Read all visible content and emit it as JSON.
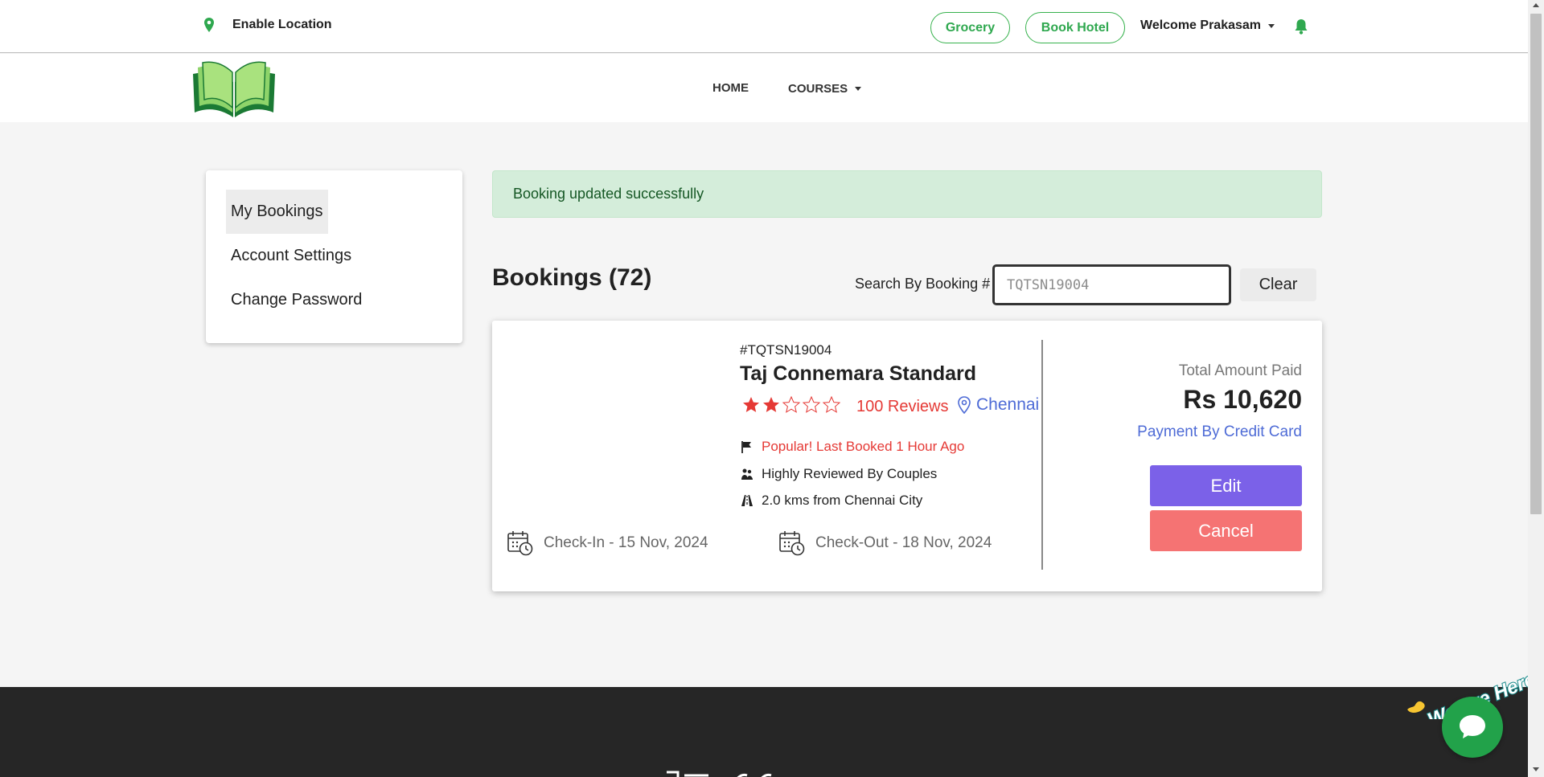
{
  "topbar": {
    "enable_location": "Enable Location",
    "grocery_label": "Grocery",
    "book_hotel_label": "Book Hotel",
    "welcome": "Welcome Prakasam"
  },
  "nav": {
    "home": "HOME",
    "courses": "COURSES"
  },
  "sidebar": {
    "items": [
      {
        "label": "My Bookings",
        "active": true
      },
      {
        "label": "Account Settings"
      },
      {
        "label": "Change Password"
      }
    ]
  },
  "alert": {
    "message": "Booking updated successfully"
  },
  "bookings": {
    "title": "Bookings (72)",
    "search_label": "Search By Booking #",
    "search_value": "TQTSN19004",
    "clear_label": "Clear"
  },
  "booking_card": {
    "booking_number": "#TQTSN19004",
    "hotel_name": "Taj Connemara Standard",
    "rating": 2,
    "rating_max": 5,
    "reviews": "100 Reviews",
    "city": "Chennai",
    "features": {
      "popular": "Popular! Last Booked 1 Hour Ago",
      "couples": "Highly Reviewed By Couples",
      "distance": "2.0 kms from Chennai City"
    },
    "check_in": "Check-In - 15 Nov, 2024",
    "check_out": "Check-Out - 18 Nov, 2024",
    "total_label": "Total Amount Paid",
    "total_amount": "Rs 10,620",
    "payment_mode": "Payment By Credit Card",
    "edit_label": "Edit",
    "cancel_label": "Cancel"
  },
  "chat": {
    "label": "We Are Here!"
  },
  "colors": {
    "brand_green": "#2fa84f",
    "edit_purple": "#7b61e8",
    "cancel_red": "#f57373",
    "link_blue": "#4e6bd6",
    "alert_bg": "#d4edda"
  }
}
